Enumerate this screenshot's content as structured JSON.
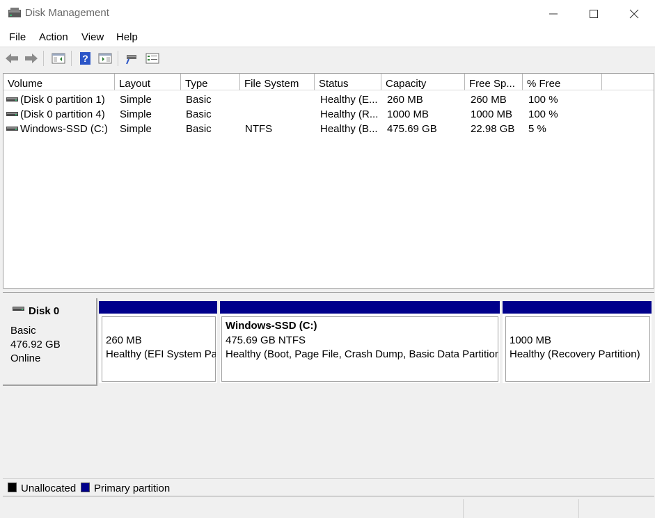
{
  "window": {
    "title": "Disk Management"
  },
  "menu": {
    "items": [
      "File",
      "Action",
      "View",
      "Help"
    ]
  },
  "toolbar": {
    "icons": [
      "back-icon",
      "forward-icon",
      "show-hide-console-tree-icon",
      "help-icon",
      "show-hide-action-pane-icon",
      "connect-icon",
      "properties-icon"
    ]
  },
  "volume_list": {
    "columns": [
      "Volume",
      "Layout",
      "Type",
      "File System",
      "Status",
      "Capacity",
      "Free Sp...",
      "% Free"
    ],
    "rows": [
      {
        "volume": "(Disk 0 partition 1)",
        "layout": "Simple",
        "type": "Basic",
        "fs": "",
        "status": "Healthy (E...",
        "capacity": "260 MB",
        "free": "260 MB",
        "pct": "100 %"
      },
      {
        "volume": "(Disk 0 partition 4)",
        "layout": "Simple",
        "type": "Basic",
        "fs": "",
        "status": "Healthy (R...",
        "capacity": "1000 MB",
        "free": "1000 MB",
        "pct": "100 %"
      },
      {
        "volume": "Windows-SSD (C:)",
        "layout": "Simple",
        "type": "Basic",
        "fs": "NTFS",
        "status": "Healthy (B...",
        "capacity": "475.69 GB",
        "free": "22.98 GB",
        "pct": "5 %"
      }
    ]
  },
  "disk": {
    "name": "Disk 0",
    "type": "Basic",
    "size": "476.92 GB",
    "state": "Online",
    "partitions": [
      {
        "title": "",
        "size": "260 MB",
        "status": "Healthy (EFI System Pa"
      },
      {
        "title": "Windows-SSD  (C:)",
        "size": "475.69 GB NTFS",
        "status": "Healthy (Boot, Page File, Crash Dump, Basic Data Partition)"
      },
      {
        "title": "",
        "size": "1000 MB",
        "status": "Healthy (Recovery Partition)"
      }
    ]
  },
  "legend": {
    "unallocated": "Unallocated",
    "primary": "Primary partition"
  },
  "colors": {
    "primary_partition": "#00008b",
    "unallocated": "#000000"
  }
}
